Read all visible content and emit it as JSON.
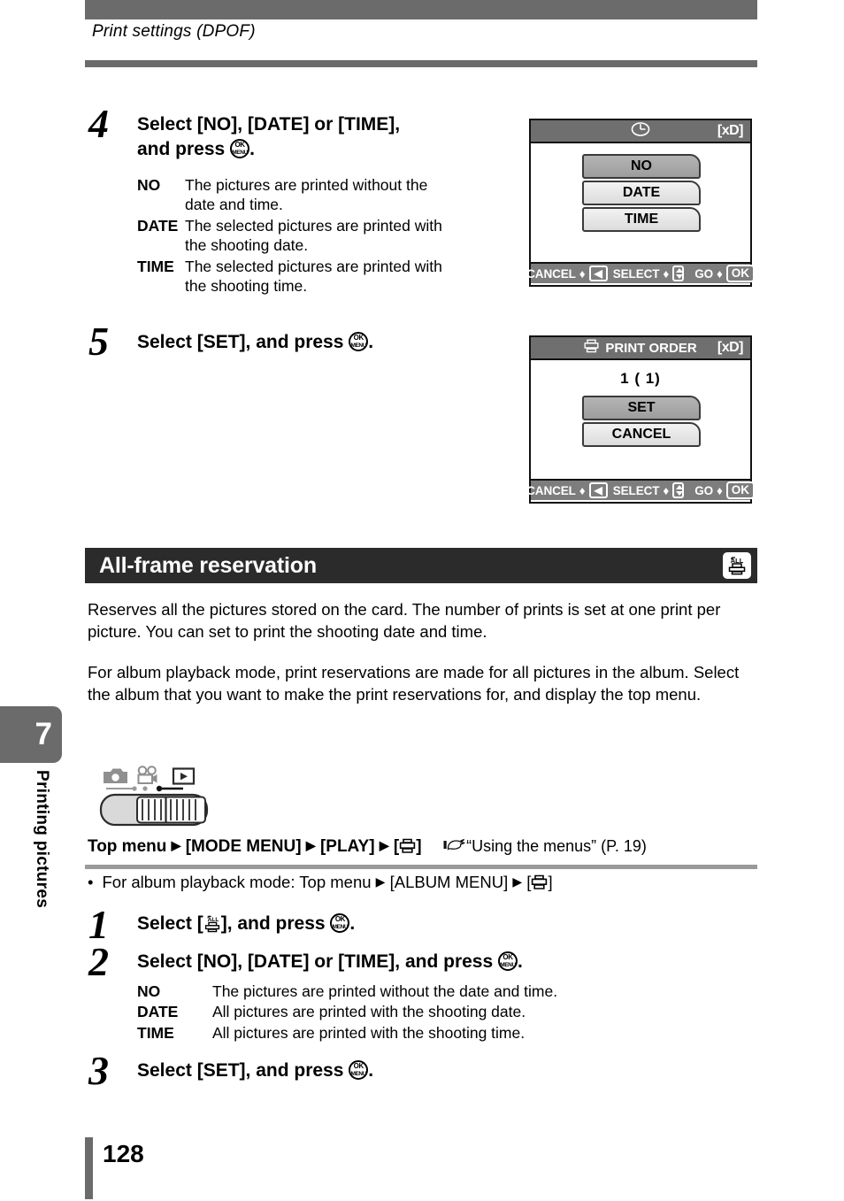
{
  "page": {
    "running_head": "Print settings (DPOF)",
    "folio": "128",
    "chapter_number": "7",
    "chapter_title": "Printing pictures"
  },
  "step4": {
    "number": "4",
    "title_line1": "Select [NO], [DATE] or [TIME],",
    "title_line2_pre": "and press",
    "title_line2_post": ".",
    "descriptions": [
      {
        "term": "NO",
        "text": "The pictures are printed without the date and time."
      },
      {
        "term": "DATE",
        "text": "The selected pictures are printed with the shooting date."
      },
      {
        "term": "TIME",
        "text": "The selected pictures are printed with the shooting time."
      }
    ]
  },
  "step5": {
    "number": "5",
    "title_pre": "Select [SET], and press",
    "title_post": "."
  },
  "lcd1": {
    "top_icon": "clock-icon",
    "card_label": "[xD]",
    "options": [
      {
        "label": "NO",
        "selected": true
      },
      {
        "label": "DATE",
        "selected": false
      },
      {
        "label": "TIME",
        "selected": false
      }
    ],
    "footer": {
      "cancel_label": "CANCEL",
      "cancel_key": "left-arrow-key",
      "select_label": "SELECT",
      "select_key": "up-down-key",
      "go_label": "GO",
      "go_key": "OK",
      "arrow": "♦"
    }
  },
  "lcd2": {
    "top_icon": "printer-icon",
    "title": "PRINT ORDER",
    "card_label": "[xD]",
    "counter": "1 (   1)",
    "options": [
      {
        "label": "SET",
        "selected": true
      },
      {
        "label": "CANCEL",
        "selected": false
      }
    ],
    "footer": {
      "cancel_label": "CANCEL",
      "cancel_key": "left-arrow-key",
      "select_label": "SELECT",
      "select_key": "up-down-key",
      "go_label": "GO",
      "go_key": "OK",
      "arrow": "♦"
    }
  },
  "section": {
    "title": "All-frame reservation",
    "icon": "print-all-icon",
    "paragraph1": "Reserves all the pictures stored on the card. The number of prints is set at one print per picture. You can set to print the shooting date and time.",
    "paragraph2": "For album playback mode, print reservations are made for all pictures in the album. Select the album that you want to make the print reservations for, and display the top menu."
  },
  "mode_figure": {
    "icons": [
      "camera-icon",
      "movie-icon",
      "playback-icon"
    ],
    "switch": "mode-switch"
  },
  "menu_path": {
    "prefix": "Top menu",
    "step1": "[MODE MENU]",
    "step2": "[PLAY]",
    "step3_open": "[",
    "step3_icon": "printer-icon",
    "step3_close": "]",
    "reference": "“Using the menus” (P. 19)",
    "triangle": "▶",
    "pointer_icon": "pointing-hand-icon",
    "album_note_pre": "For album playback mode: Top menu",
    "album_note_mid": "[ALBUM MENU]",
    "album_note_open": "[",
    "album_note_close": "]",
    "bullet": "•"
  },
  "step1": {
    "number": "1",
    "title_pre": "Select [",
    "title_icon": "print-all-icon",
    "title_mid": "], and press",
    "title_post": "."
  },
  "step2": {
    "number": "2",
    "title_pre": "Select [NO], [DATE] or [TIME], and press",
    "title_post": ".",
    "descriptions": [
      {
        "term": "NO",
        "text": "The pictures are printed without the date and time."
      },
      {
        "term": "DATE",
        "text": "All pictures are printed with the shooting date."
      },
      {
        "term": "TIME",
        "text": "All pictures are printed with the shooting time."
      }
    ]
  },
  "step3": {
    "number": "3",
    "title_pre": "Select [SET], and press",
    "title_post": "."
  },
  "colors": {
    "band_gray": "#6b6b6b",
    "section_black": "#2b2b2b",
    "lcd_header_gray": "#6f6f6f",
    "lcd_footer_gray": "#7d7d7d",
    "selected_option_gray": "#a8a8a8"
  }
}
